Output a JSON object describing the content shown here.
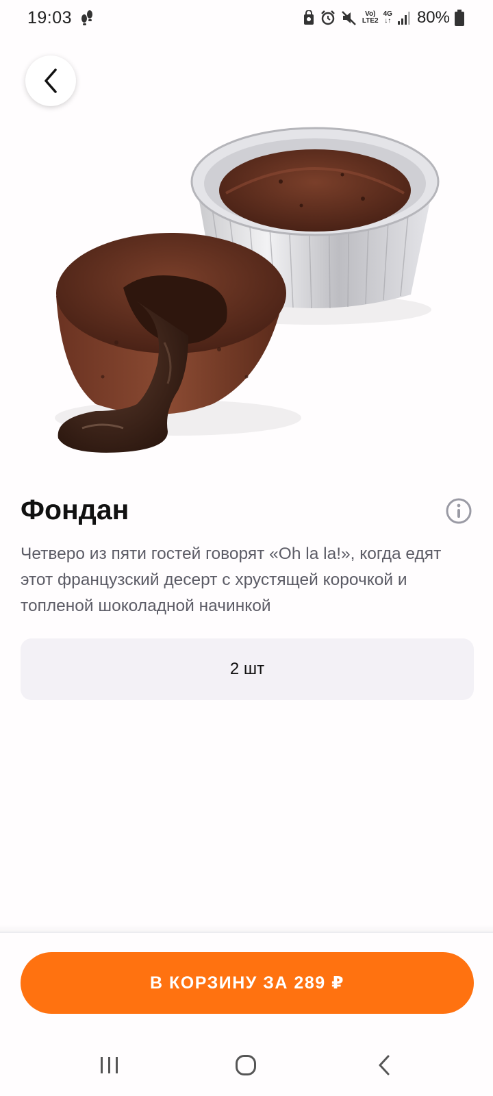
{
  "status_bar": {
    "time": "19:03",
    "network_top": "Vo)",
    "network_bottom": "LTE2",
    "data_type": "4G",
    "battery": "80%",
    "icons": [
      "steps-icon",
      "shield-icon",
      "alarm-icon",
      "mute-icon",
      "volte-icon",
      "4g-icon",
      "signal-icon",
      "battery-icon"
    ]
  },
  "header": {
    "back_icon": "chevron-left-icon"
  },
  "product": {
    "image": "chocolate-fondant-image",
    "title": "Фондан",
    "info_icon": "info-icon",
    "description": "Четверо из пяти гостей говорят «Oh la la!», когда едят этот французский десерт с хрустящей корочкой и топленой шоколадной начинкой"
  },
  "size_selector": {
    "selected": "2 шт"
  },
  "cart": {
    "button_label": "В КОРЗИНУ ЗА 289 ₽"
  },
  "colors": {
    "accent": "#ff7210",
    "selector_bg": "#f3f1f6",
    "description_text": "#5c5c66",
    "background": "#fffdfe"
  },
  "nav_bar": {
    "icons": [
      "recents-icon",
      "home-icon",
      "back-icon"
    ]
  }
}
